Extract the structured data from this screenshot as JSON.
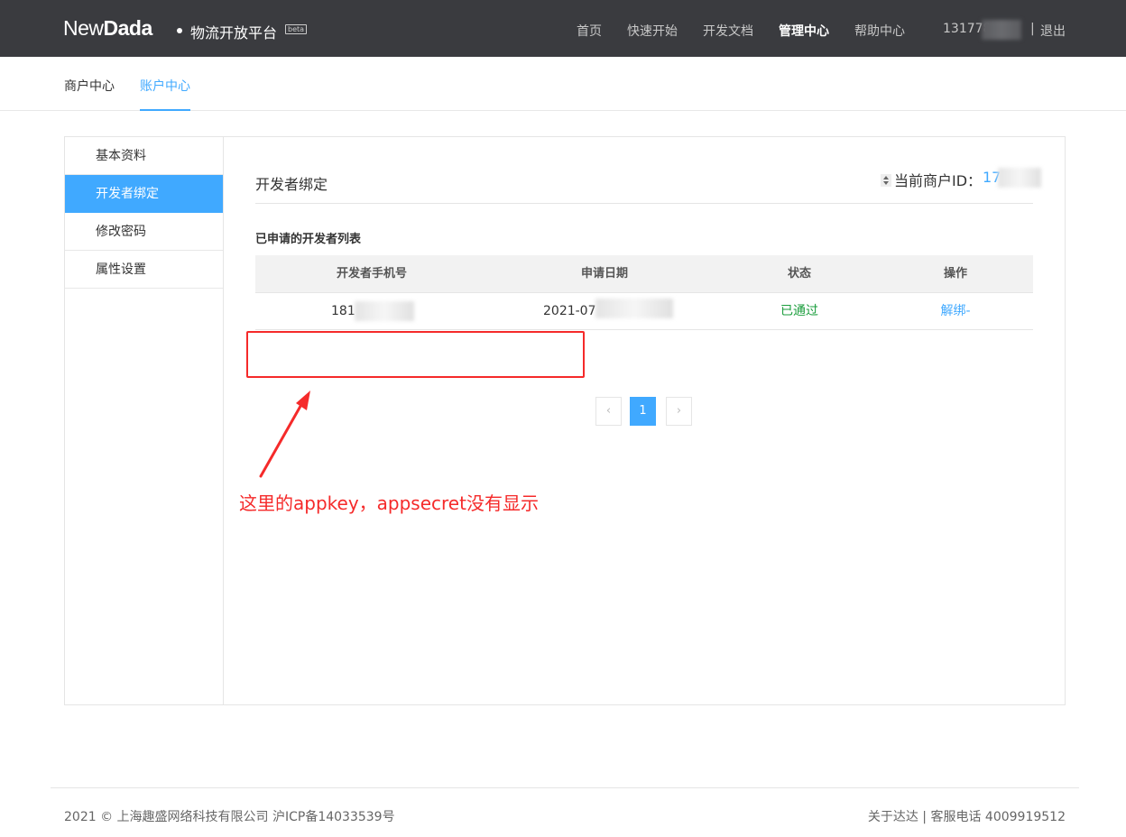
{
  "header": {
    "logo_new": "New",
    "logo_dada": "Dada",
    "platform": "物流开放平台",
    "beta": "beta",
    "nav": [
      "首页",
      "快速开始",
      "开发文档",
      "管理中心",
      "帮助中心"
    ],
    "active_nav": "管理中心",
    "user_phone": "131778",
    "separator": "|",
    "logout": "退出"
  },
  "subnav": {
    "tabs": [
      "商户中心",
      "账户中心"
    ],
    "active": "账户中心"
  },
  "sidebar": {
    "items": [
      "基本资料",
      "开发者绑定",
      "修改密码",
      "属性设置"
    ],
    "active": "开发者绑定"
  },
  "content": {
    "title": "开发者绑定",
    "merchant_label": "当前商户ID：",
    "merchant_id": "17",
    "list_title": "已申请的开发者列表",
    "columns": [
      "开发者手机号",
      "申请日期",
      "状态",
      "操作"
    ],
    "rows": [
      {
        "phone": "181",
        "date": "2021-07",
        "status": "已通过",
        "action": "解绑-"
      }
    ]
  },
  "pagination": {
    "prev": "‹",
    "page": "1",
    "next": "›"
  },
  "annotation": "这里的appkey，appsecret没有显示",
  "footer": {
    "left": "2021 © 上海趣盛网络科技有限公司 沪ICP备14033539号",
    "about": "关于达达",
    "sep": "|",
    "service": "客服电话 4009919512"
  },
  "colors": {
    "accent": "#40a9ff",
    "topbar": "#3a3b3f",
    "success": "#1a9d3c",
    "annotation": "#f52a2a"
  }
}
